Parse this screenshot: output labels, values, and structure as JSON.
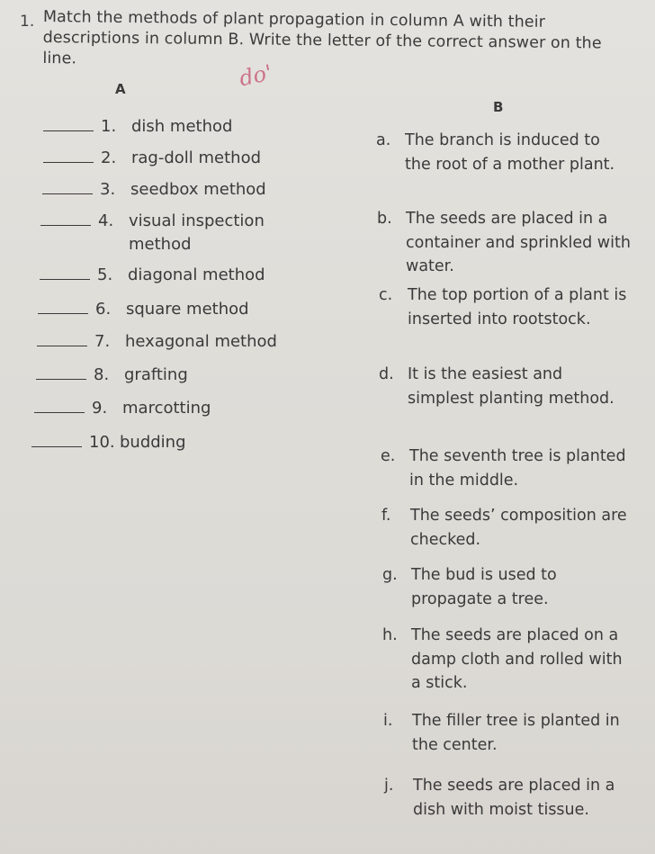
{
  "question": {
    "number": "1.",
    "instructions": "Match the methods of plant propagation in column A with their descriptions in column B. Write the letter of the correct answer on the line.",
    "handwritten_mark": "do'"
  },
  "column_a": {
    "heading": "A",
    "items": [
      {
        "number": "1.",
        "text": "dish method",
        "answer": ""
      },
      {
        "number": "2.",
        "text": "rag-doll method",
        "answer": ""
      },
      {
        "number": "3.",
        "text": "seedbox method",
        "answer": ""
      },
      {
        "number": "4.",
        "text": "visual inspection",
        "text_cont": "method",
        "answer": ""
      },
      {
        "number": "5.",
        "text": "diagonal method",
        "answer": ""
      },
      {
        "number": "6.",
        "text": "square method",
        "answer": ""
      },
      {
        "number": "7.",
        "text": "hexagonal method",
        "answer": ""
      },
      {
        "number": "8.",
        "text": "grafting",
        "answer": ""
      },
      {
        "number": "9.",
        "text": "marcotting",
        "answer": ""
      },
      {
        "number": "10.",
        "text": "budding",
        "answer": ""
      }
    ]
  },
  "column_b": {
    "heading": "B",
    "items": [
      {
        "letter": "a.",
        "text": "The branch is induced to the root of a mother plant."
      },
      {
        "letter": "b.",
        "text": "The seeds are placed in a container and sprinkled with water."
      },
      {
        "letter": "c.",
        "text": "The top portion of a plant is inserted into rootstock."
      },
      {
        "letter": "d.",
        "text": "It is the easiest and simplest planting method."
      },
      {
        "letter": "e.",
        "text": "The seventh tree is planted in the middle."
      },
      {
        "letter": "f.",
        "text": "The seeds’ composition are checked."
      },
      {
        "letter": "g.",
        "text": "The bud is used to propagate a tree."
      },
      {
        "letter": "h.",
        "text": "The seeds are placed on a damp cloth and rolled with a stick."
      },
      {
        "letter": "i.",
        "text": "The filler tree is planted in the center."
      },
      {
        "letter": "j.",
        "text": "The seeds are placed in a dish with moist tissue."
      }
    ]
  }
}
